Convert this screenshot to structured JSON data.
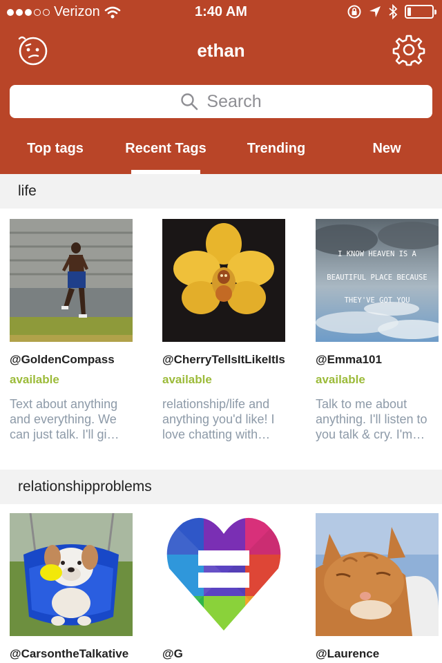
{
  "status_bar": {
    "carrier": "Verizon",
    "time": "1:40 AM",
    "signal_bars_filled": 3,
    "signal_bars_total": 5,
    "battery_level": 0.15
  },
  "nav": {
    "title": "ethan",
    "left_icon": "confused-face-icon",
    "right_icon": "gear-icon"
  },
  "search": {
    "placeholder": "Search"
  },
  "tabs": [
    {
      "label": "Top tags",
      "active": false
    },
    {
      "label": "Recent Tags",
      "active": true
    },
    {
      "label": "Trending",
      "active": false
    },
    {
      "label": "New",
      "active": false
    }
  ],
  "colors": {
    "brand": "#b94528",
    "available": "#9cbb3a",
    "description": "#8d9aa8"
  },
  "sections": [
    {
      "title": "life",
      "cards": [
        {
          "username": "@GoldenCompass",
          "status": "available",
          "description": "Text about anything and everything. We can just talk. I'll gi…"
        },
        {
          "username": "@CherryTellsItLikeItIs",
          "status": "available",
          "description": "relationship/life and anything you'd like! I love chatting with…"
        },
        {
          "username": "@Emma101",
          "status": "available",
          "description": "Talk to me about anything. I'll listen to you talk & cry. I'm…",
          "image_text": [
            "I KNOW HEAVEN IS A",
            "BEAUTIFUL PLACE BECAUSE",
            "THEY'VE GOT YOU"
          ]
        }
      ]
    },
    {
      "title": "relationshipproblems",
      "cards": [
        {
          "username": "@CarsontheTalkative"
        },
        {
          "username": "@G"
        },
        {
          "username": "@Laurence"
        }
      ]
    }
  ]
}
